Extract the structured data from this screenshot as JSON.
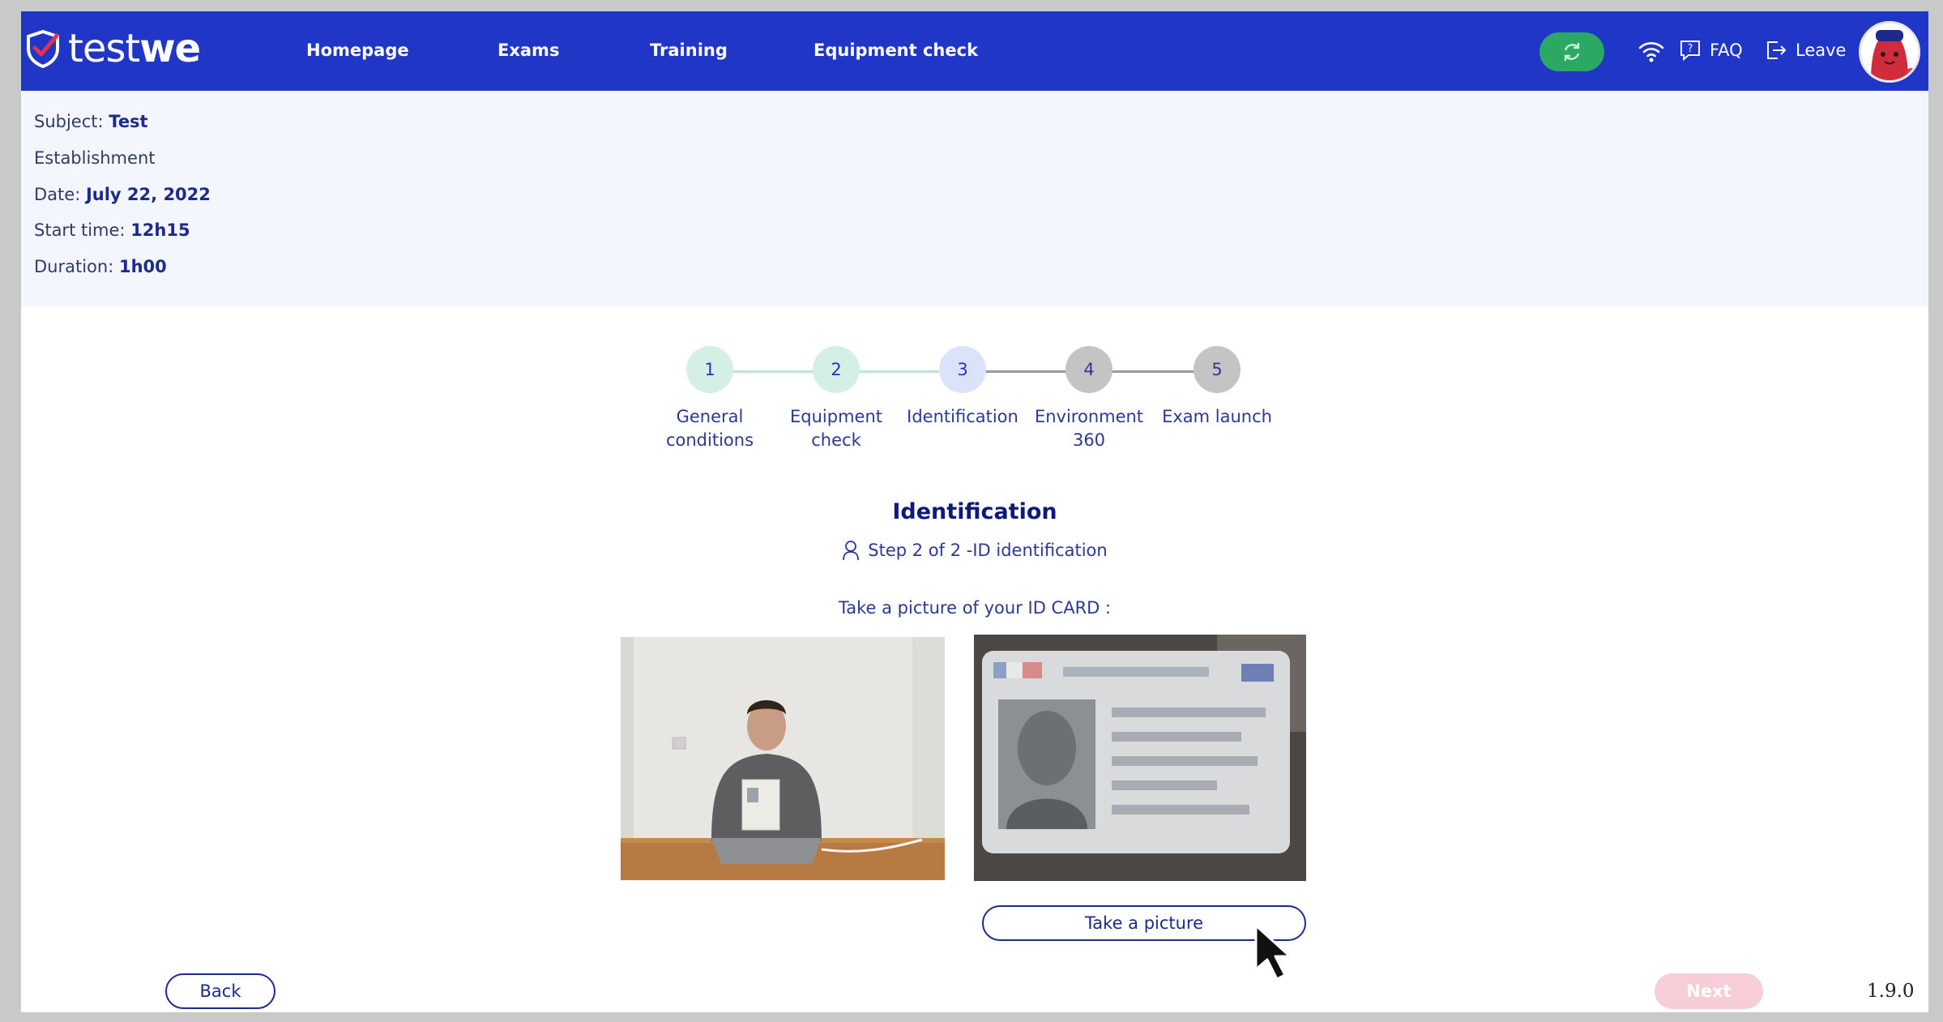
{
  "app": {
    "logo_text_light": "test",
    "logo_text_bold": "we"
  },
  "nav": {
    "items": [
      {
        "label": "Homepage"
      },
      {
        "label": "Exams"
      },
      {
        "label": "Training"
      },
      {
        "label": "Equipment check"
      }
    ],
    "faq_label": "FAQ",
    "leave_label": "Leave",
    "sync_icon": "sync-icon",
    "wifi_icon": "wifi-icon"
  },
  "exam_info": {
    "subject_label": "Subject:",
    "subject_value": "Test",
    "establishment_label": "Establishment",
    "date_label": "Date:",
    "date_value": "July 22, 2022",
    "start_label": "Start time:",
    "start_value": "12h15",
    "duration_label": "Duration:",
    "duration_value": "1h00"
  },
  "stepper": {
    "steps": [
      {
        "number": "1",
        "label_line1": "General",
        "label_line2": "conditions",
        "state": "done"
      },
      {
        "number": "2",
        "label_line1": "Equipment",
        "label_line2": "check",
        "state": "done"
      },
      {
        "number": "3",
        "label_line1": "Identification",
        "label_line2": "",
        "state": "current"
      },
      {
        "number": "4",
        "label_line1": "Environment",
        "label_line2": "360",
        "state": "pending"
      },
      {
        "number": "5",
        "label_line1": "Exam launch",
        "label_line2": "",
        "state": "pending"
      }
    ]
  },
  "identification": {
    "title": "Identification",
    "step_text": "Step 2 of 2 -ID identification",
    "instruction": "Take a picture of your ID CARD :",
    "take_picture_label": "Take a picture"
  },
  "footer": {
    "back_label": "Back",
    "next_label": "Next",
    "version": "1.9.0"
  },
  "colors": {
    "brand_blue": "#1f36c7",
    "sync_green": "#2aa864",
    "step_done": "#d4efe3",
    "step_current": "#dbe3fb",
    "step_pending": "#c4c4c4",
    "next_disabled": "#f7cdd7"
  }
}
